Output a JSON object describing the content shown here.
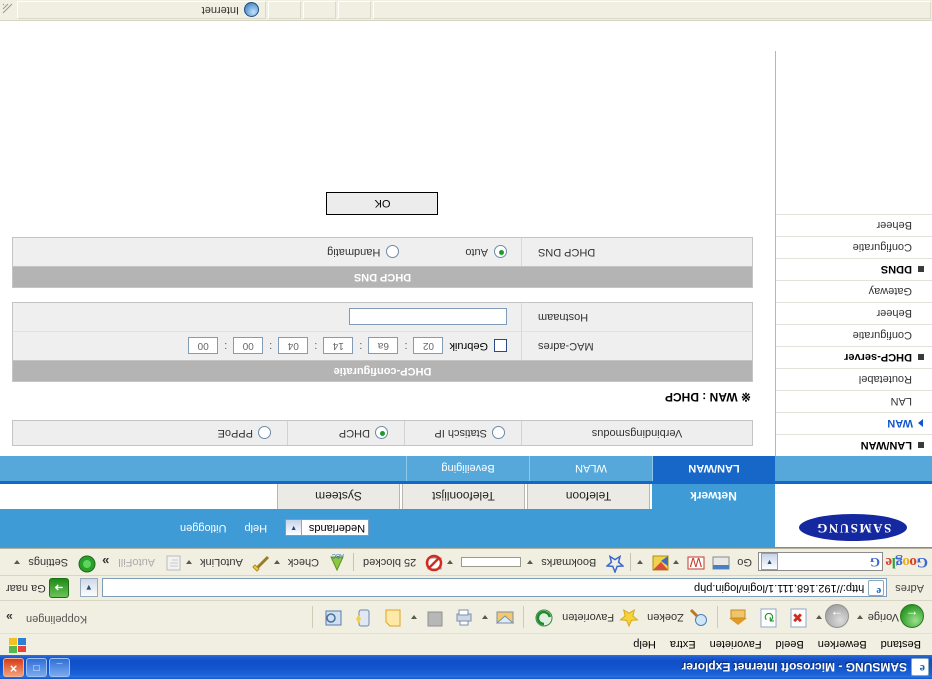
{
  "window": {
    "title": "SAMSUNG - Microsoft Internet Explorer",
    "min_label": "_",
    "max_label": "□",
    "close_label": "✕"
  },
  "menubar": {
    "items": [
      "Bestand",
      "Bewerken",
      "Beeld",
      "Favorieten",
      "Extra",
      "Help"
    ]
  },
  "toolbar": {
    "back_label": "Vorige",
    "forward_label": "",
    "stop_label": "",
    "refresh_label": "",
    "home_label": "",
    "search_label": "Zoeken",
    "favorites_label": "Favorieten",
    "history_label": "",
    "mail_label": "",
    "print_label": "",
    "edit_label": "",
    "discuss_label": "",
    "messenger_label": "",
    "research_label": "",
    "links_label": "Koppelingen",
    "overflow_label": "»"
  },
  "address": {
    "label": "Adres",
    "url": "http://192.168.111.1/login/login.php",
    "go_label": "Ga naar",
    "dropdown_glyph": "▼"
  },
  "google_toolbar": {
    "logo": [
      "G",
      "o",
      "o",
      "g",
      "l",
      "e"
    ],
    "search_value": "",
    "search_prefix": "G",
    "go_label": "Go",
    "bookmarks_label": "Bookmarks",
    "pagerank_label": "PageRank",
    "blocked_label": "25 blocked",
    "check_label": "Check",
    "autolink_label": "AutoLink",
    "autofill_label": "AutoFill",
    "settings_label": "Settings",
    "overflow_label": "»"
  },
  "brand": {
    "logo_text": "SAMSUNG",
    "logout_label": "Uitloggen",
    "help_label": "Help",
    "language_value": "Nederlands",
    "language_arrow": "▼"
  },
  "tabs": [
    {
      "label": "Systeem",
      "active": false
    },
    {
      "label": "Telefoonlijst",
      "active": false
    },
    {
      "label": "Telefoon",
      "active": false
    },
    {
      "label": "Netwerk",
      "active": true
    }
  ],
  "subtabs": [
    {
      "label": "Beveiliging",
      "active": false
    },
    {
      "label": "WLAN",
      "active": false
    },
    {
      "label": "LAN/WAN",
      "active": true
    }
  ],
  "sidebar": {
    "items": [
      {
        "label": "LAN/WAN",
        "type": "head"
      },
      {
        "label": "WAN",
        "type": "child",
        "selected": true
      },
      {
        "label": "LAN",
        "type": "child"
      },
      {
        "label": "Routetabel",
        "type": "child"
      },
      {
        "label": "DHCP-server",
        "type": "head"
      },
      {
        "label": "Configuratie",
        "type": "child"
      },
      {
        "label": "Beheer",
        "type": "child"
      },
      {
        "label": "Gateway",
        "type": "child"
      },
      {
        "label": "DDNS",
        "type": "head"
      },
      {
        "label": "Configuratie",
        "type": "child"
      },
      {
        "label": "Beheer",
        "type": "child"
      }
    ]
  },
  "main": {
    "mode_row": {
      "label": "Verbindingsmodus",
      "options": [
        {
          "label": "Statisch IP",
          "selected": false
        },
        {
          "label": "DHCP",
          "selected": true
        },
        {
          "label": "PPPoE",
          "selected": false
        }
      ]
    },
    "section_title": "※ WAN : DHCP",
    "dhcp_config": {
      "header": "DHCP-configuratie",
      "mac_label": "MAC-adres",
      "mac_checkbox_label": "Gebruik",
      "mac_checked": false,
      "mac_octets": [
        "02",
        "6a",
        "14",
        "04",
        "00",
        "00"
      ],
      "mac_separator": ":",
      "host_label": "Hostnaam",
      "host_value": ""
    },
    "dhcp_dns": {
      "header": "DHCP DNS",
      "label": "DHCP DNS",
      "options": [
        {
          "label": "Auto",
          "selected": true
        },
        {
          "label": "Handmatig",
          "selected": false
        }
      ]
    },
    "ok_label": "OK"
  },
  "statusbar": {
    "zone_label": "Internet"
  }
}
